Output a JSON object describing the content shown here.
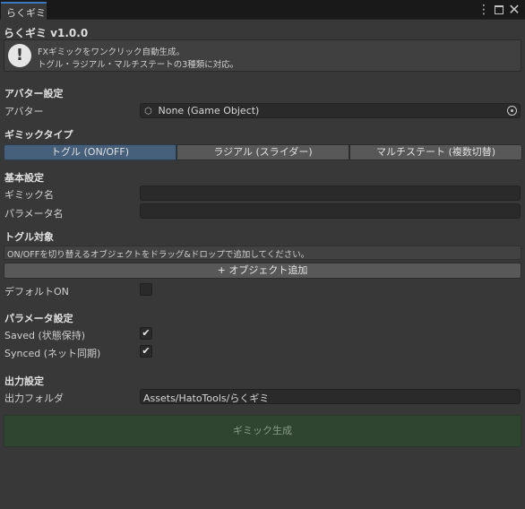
{
  "window": {
    "tab_title": "らくギミ",
    "icons": [
      "menu-icon",
      "maximize-icon",
      "close-icon"
    ]
  },
  "header": {
    "title": "らくギミ v1.0.0",
    "help_lines": [
      "FXギミックをワンクリック自動生成。",
      "トグル・ラジアル・マルチステートの3種類に対応。"
    ]
  },
  "avatar_section": {
    "heading": "アバター設定",
    "avatar_label": "アバター",
    "avatar_value": "None (Game Object)"
  },
  "gimmick_type": {
    "heading": "ギミックタイプ",
    "options": [
      "トグル (ON/OFF)",
      "ラジアル (スライダー)",
      "マルチステート (複数切替)"
    ],
    "selected": "トグル (ON/OFF)"
  },
  "basic": {
    "heading": "基本設定",
    "gimmick_name_label": "ギミック名",
    "gimmick_name_value": "",
    "param_name_label": "パラメータ名",
    "param_name_value": ""
  },
  "toggle_target": {
    "heading": "トグル対象",
    "info": "ON/OFFを切り替えるオブジェクトをドラッグ&ドロップで追加してください。",
    "add_button": "+ オブジェクト追加",
    "default_on_label": "デフォルトON",
    "default_on": false
  },
  "params": {
    "heading": "パラメータ設定",
    "saved_label": "Saved (状態保持)",
    "saved": true,
    "synced_label": "Synced (ネット同期)",
    "synced": true
  },
  "output": {
    "heading": "出力設定",
    "folder_label": "出力フォルダ",
    "folder_value": "Assets/HatoTools/らくギミ"
  },
  "generate_button": "ギミック生成",
  "colors": {
    "accent_selected": "#46607c",
    "generate_bg": "#2f4530"
  }
}
